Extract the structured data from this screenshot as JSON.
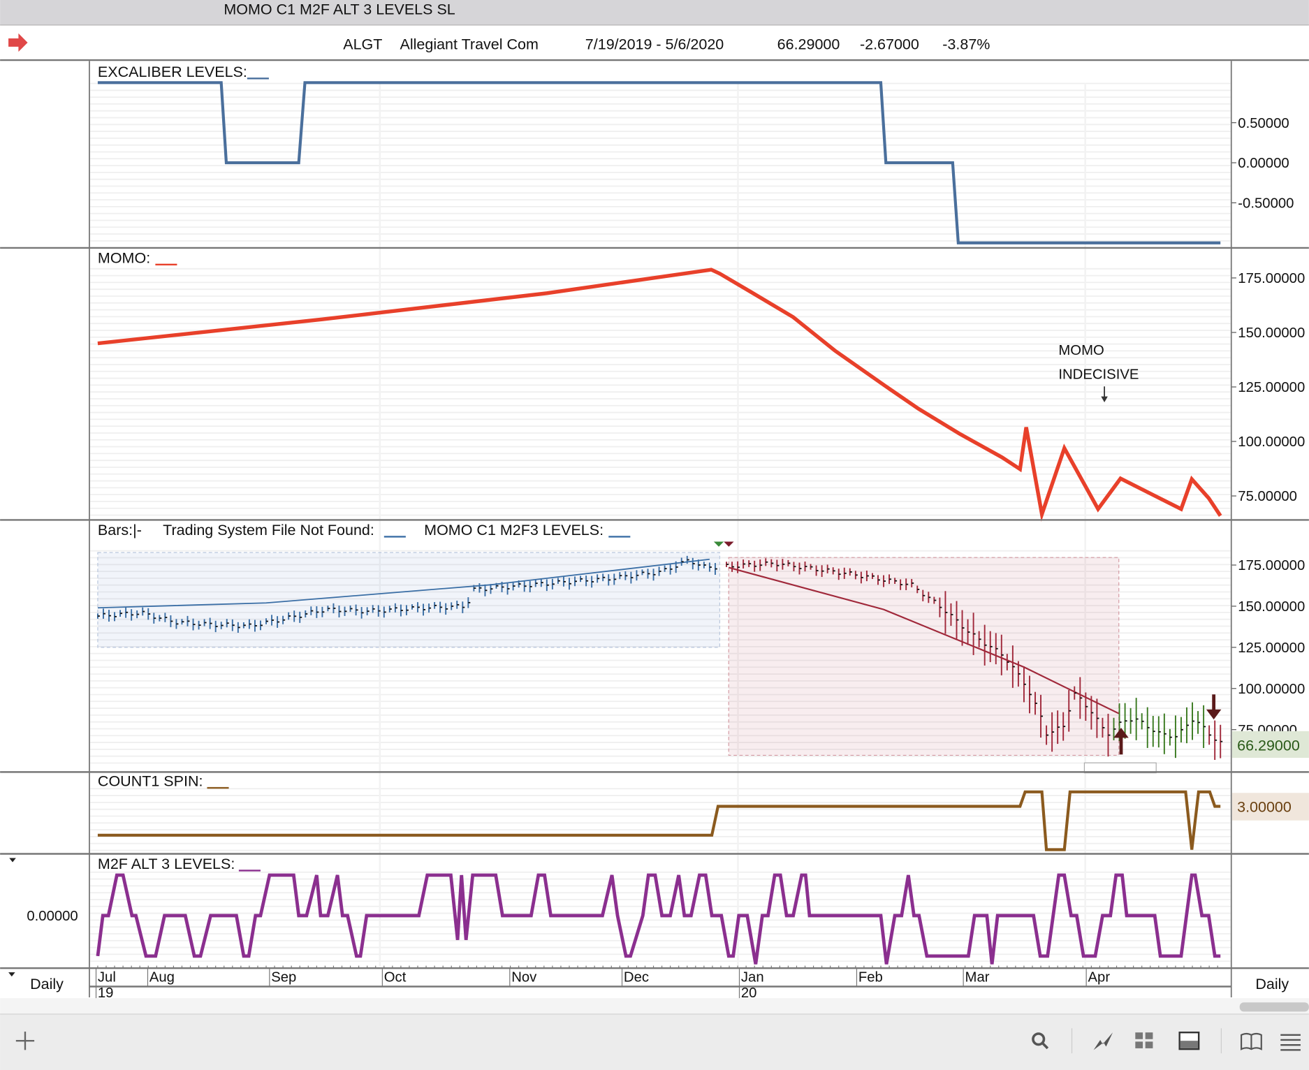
{
  "window": {
    "title": "MOMO C1 M2F ALT 3 LEVELS  SL"
  },
  "header": {
    "symbol": "ALGT",
    "company": "Allegiant Travel Com",
    "date_range": "7/19/2019 - 5/6/2020",
    "last": "66.29000",
    "change": "-2.67000",
    "change_pct": "-3.87%"
  },
  "colors": {
    "excaliber": "#4a6f9c",
    "momo": "#e8402a",
    "count1": "#8b5a1e",
    "m2f": "#8b2f8f",
    "bars_up": "#3a6ea5",
    "bars_down": "#a0283a",
    "bars_green": "#3a7a20"
  },
  "footer": {
    "period_left": "Daily",
    "period_right": "Daily"
  },
  "toolbar": [
    "add-icon",
    "search-icon",
    "chart-line-icon",
    "grid-icon",
    "panel-icon",
    "book-icon",
    "menu-icon"
  ],
  "chart_data": [
    {
      "type": "line",
      "title": "EXCALIBER LEVELS:",
      "x_unit": "trading day index (0 = 7/19/2019, 200 = 5/6/2020)",
      "yticks": [
        "0.50000",
        "0.00000",
        "-0.50000"
      ],
      "ytick_values": [
        0.5,
        0,
        -0.5
      ],
      "ylim": [
        -1,
        1
      ],
      "series": [
        {
          "name": "Excaliber",
          "points": [
            [
              0,
              1
            ],
            [
              22,
              1
            ],
            [
              22.9,
              0
            ],
            [
              35.8,
              0
            ],
            [
              36.9,
              1
            ],
            [
              139.5,
              1
            ],
            [
              140.4,
              0
            ],
            [
              152.3,
              0
            ],
            [
              153.3,
              -1
            ],
            [
              200,
              -1
            ]
          ]
        }
      ]
    },
    {
      "type": "line",
      "title": "MOMO:",
      "yticks": [
        "175.00000",
        "150.00000",
        "125.00000",
        "100.00000",
        "75.00000"
      ],
      "ytick_values": [
        175,
        150,
        125,
        100,
        75
      ],
      "annotation": {
        "line1": "MOMO",
        "line2": "INDECISIVE",
        "day": 181
      },
      "series": [
        {
          "name": "MOMO",
          "points": [
            [
              0,
              145
            ],
            [
              40,
              156
            ],
            [
              80,
              168
            ],
            [
              109.3,
              178.8
            ],
            [
              110.8,
              177
            ],
            [
              116.4,
              168.5
            ],
            [
              123.9,
              157
            ],
            [
              131.3,
              141.7
            ],
            [
              140.2,
              125.6
            ],
            [
              146.2,
              115
            ],
            [
              153.6,
              103.4
            ],
            [
              161.1,
              92.7
            ],
            [
              164.3,
              87.3
            ],
            [
              165.4,
              106.5
            ],
            [
              168.2,
              66.6
            ],
            [
              172.2,
              96.9
            ],
            [
              178.2,
              69
            ],
            [
              182.2,
              83
            ],
            [
              193,
              69
            ],
            [
              194.9,
              82.7
            ],
            [
              197.9,
              74
            ],
            [
              200,
              65.9
            ]
          ]
        }
      ]
    },
    {
      "type": "bar",
      "title": "Bars:|-",
      "title2": "Trading System File Not Found:",
      "title3": "MOMO C1 M2F3 LEVELS:",
      "yticks": [
        "175.00000",
        "150.00000",
        "125.00000",
        "100.00000",
        "75.00000"
      ],
      "ytick_values": [
        175,
        150,
        125,
        100,
        75
      ],
      "last_price": "66.29000",
      "close_anchors": [
        [
          0,
          144
        ],
        [
          8,
          146
        ],
        [
          14,
          140.5
        ],
        [
          20,
          139
        ],
        [
          28,
          138
        ],
        [
          34,
          142
        ],
        [
          42,
          148
        ],
        [
          50,
          147
        ],
        [
          60,
          149
        ],
        [
          68,
          150
        ],
        [
          69,
          160
        ],
        [
          80,
          163
        ],
        [
          95,
          167
        ],
        [
          104,
          171
        ],
        [
          109,
          178
        ],
        [
          112,
          173.5
        ],
        [
          125,
          176
        ],
        [
          140,
          169
        ],
        [
          150,
          163
        ],
        [
          156,
          148
        ],
        [
          161,
          133
        ],
        [
          167,
          120
        ],
        [
          171,
          102.5
        ],
        [
          174,
          82
        ],
        [
          175,
          72
        ],
        [
          178,
          77
        ],
        [
          180,
          97
        ],
        [
          183,
          87
        ],
        [
          186,
          72
        ],
        [
          189,
          80
        ],
        [
          191,
          82
        ],
        [
          196,
          72
        ],
        [
          199,
          71
        ],
        [
          202,
          82
        ],
        [
          205,
          72
        ],
        [
          207,
          67
        ]
      ],
      "up_zone": {
        "from_day": 0,
        "to_day": 110.8,
        "low": 125,
        "high": 182.6
      },
      "down_zone": {
        "from_day": 112.4,
        "to_day": 181.9,
        "low": 59.4,
        "high": 179.6
      },
      "ma_up": [
        [
          0,
          149
        ],
        [
          30,
          152
        ],
        [
          70,
          163
        ],
        [
          109,
          178.5
        ]
      ],
      "ma_down": [
        [
          112.4,
          173.5
        ],
        [
          140,
          148
        ],
        [
          165,
          113
        ],
        [
          181.9,
          84.8
        ]
      ]
    },
    {
      "type": "line",
      "title": "COUNT1 SPIN:",
      "last_value": "3.00000",
      "series": [
        {
          "name": "COUNT1",
          "points": [
            [
              0,
              1
            ],
            [
              109.4,
              1
            ],
            [
              110.5,
              3
            ],
            [
              164.3,
              3
            ],
            [
              165.2,
              4
            ],
            [
              168.2,
              4
            ],
            [
              169,
              0
            ],
            [
              172.2,
              0
            ],
            [
              173.2,
              4
            ],
            [
              193.8,
              4
            ],
            [
              194.9,
              0
            ],
            [
              196.1,
              4
            ],
            [
              198.1,
              4
            ],
            [
              199,
              3
            ],
            [
              200,
              3
            ]
          ]
        }
      ]
    },
    {
      "type": "line",
      "title": "M2F ALT 3 LEVELS:",
      "yticks": [
        "0.00000"
      ],
      "ytick_values": [
        0
      ],
      "series": [
        {
          "name": "M2F",
          "points": [
            [
              0,
              -1
            ],
            [
              0.9,
              0
            ],
            [
              1.9,
              0
            ],
            [
              3.4,
              1
            ],
            [
              4.5,
              1
            ],
            [
              6.1,
              0
            ],
            [
              6.8,
              0
            ],
            [
              8.6,
              -1
            ],
            [
              10.3,
              -1
            ],
            [
              11.9,
              0
            ],
            [
              15.6,
              0
            ],
            [
              17.2,
              -1
            ],
            [
              18.3,
              -1
            ],
            [
              20.1,
              0
            ],
            [
              24.7,
              0
            ],
            [
              26,
              -1
            ],
            [
              26.9,
              -1
            ],
            [
              28.1,
              0
            ],
            [
              29,
              0
            ],
            [
              30.6,
              1
            ],
            [
              34.9,
              1
            ],
            [
              35.8,
              0
            ],
            [
              37.2,
              0
            ],
            [
              39,
              1
            ],
            [
              39.7,
              0
            ],
            [
              41,
              0
            ],
            [
              42.7,
              1
            ],
            [
              43.6,
              0
            ],
            [
              44.5,
              0
            ],
            [
              46.1,
              -1
            ],
            [
              46.8,
              -1
            ],
            [
              47.9,
              0
            ],
            [
              57.2,
              0
            ],
            [
              58.7,
              1
            ],
            [
              62.9,
              1
            ],
            [
              64.1,
              -0.6
            ],
            [
              64.8,
              1
            ],
            [
              65.6,
              -0.6
            ],
            [
              66.8,
              1
            ],
            [
              70.9,
              1
            ],
            [
              72.1,
              0
            ],
            [
              77.2,
              0
            ],
            [
              78.5,
              1
            ],
            [
              79.6,
              1
            ],
            [
              80.7,
              0
            ],
            [
              89.9,
              0
            ],
            [
              91.6,
              1
            ],
            [
              92.6,
              0
            ],
            [
              94.1,
              -1
            ],
            [
              94.9,
              -1
            ],
            [
              97.1,
              0
            ],
            [
              98.1,
              1
            ],
            [
              99.3,
              1
            ],
            [
              100.5,
              0
            ],
            [
              102,
              0
            ],
            [
              103.5,
              1
            ],
            [
              104.5,
              0
            ],
            [
              105.7,
              0
            ],
            [
              107.2,
              1
            ],
            [
              108.3,
              1
            ],
            [
              109.4,
              0
            ],
            [
              111.1,
              0
            ],
            [
              112.4,
              -1
            ],
            [
              113.2,
              -1
            ],
            [
              114.2,
              0
            ],
            [
              115.7,
              0
            ],
            [
              117.2,
              -1.2
            ],
            [
              118.4,
              0
            ],
            [
              119.4,
              0
            ],
            [
              120.6,
              1
            ],
            [
              121.6,
              1
            ],
            [
              122.7,
              0
            ],
            [
              123.9,
              0
            ],
            [
              125.4,
              1
            ],
            [
              126.1,
              1
            ],
            [
              126.8,
              0
            ],
            [
              139.5,
              0
            ],
            [
              140.5,
              -1.2
            ],
            [
              142,
              0
            ],
            [
              143.2,
              0
            ],
            [
              144.4,
              1
            ],
            [
              145.4,
              0
            ],
            [
              146.3,
              0
            ],
            [
              147.7,
              -1
            ],
            [
              155.1,
              -1
            ],
            [
              156.2,
              0
            ],
            [
              158.4,
              0
            ],
            [
              159.3,
              -1.2
            ],
            [
              160.3,
              0
            ],
            [
              166.7,
              0
            ],
            [
              167.9,
              -1
            ],
            [
              169.2,
              -1
            ],
            [
              171.2,
              1
            ],
            [
              172.2,
              1
            ],
            [
              173.4,
              0
            ],
            [
              174.4,
              0
            ],
            [
              175.6,
              -1
            ],
            [
              177.7,
              -1
            ],
            [
              179,
              0
            ],
            [
              180.4,
              0
            ],
            [
              181.4,
              1
            ],
            [
              182.5,
              1
            ],
            [
              183.3,
              0
            ],
            [
              188.3,
              0
            ],
            [
              189.3,
              -1
            ],
            [
              193,
              -1
            ],
            [
              194.9,
              1
            ],
            [
              195.5,
              1
            ],
            [
              196.7,
              0
            ],
            [
              197.9,
              0
            ],
            [
              199,
              -1
            ],
            [
              200,
              -1
            ]
          ]
        }
      ]
    }
  ],
  "x_axis": {
    "months": [
      {
        "label": "Jul",
        "day": -0.3
      },
      {
        "label": "Aug",
        "day": 8.9
      },
      {
        "label": "Sep",
        "day": 30.6
      },
      {
        "label": "Oct",
        "day": 50.7
      },
      {
        "label": "Nov",
        "day": 73.4
      },
      {
        "label": "Dec",
        "day": 93.4
      },
      {
        "label": "Jan",
        "day": 114.3
      },
      {
        "label": "Feb",
        "day": 135.2
      },
      {
        "label": "Mar",
        "day": 154.2
      },
      {
        "label": "Apr",
        "day": 176.1
      }
    ],
    "years": [
      {
        "label": "19",
        "day": -0.3
      },
      {
        "label": "20",
        "day": 114.3
      }
    ]
  }
}
